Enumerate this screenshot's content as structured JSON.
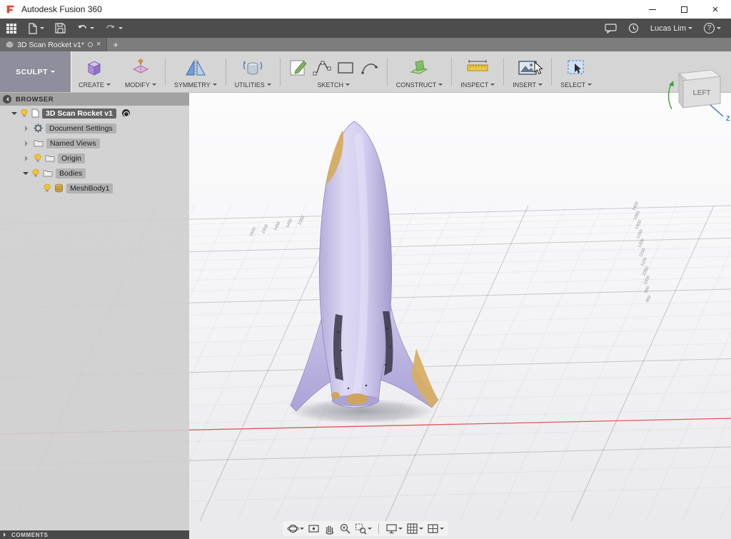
{
  "window": {
    "title": "Autodesk Fusion 360"
  },
  "appbar": {
    "user": "Lucas Lim",
    "help_glyph": "?"
  },
  "tabbar": {
    "active_tab": "3D Scan Rocket v1*",
    "close_glyph": "×",
    "new_tab_glyph": "+"
  },
  "ribbon": {
    "workspace": "SCULPT",
    "groups": [
      {
        "label": "CREATE"
      },
      {
        "label": "MODIFY"
      },
      {
        "label": "SYMMETRY"
      },
      {
        "label": "UTILITIES"
      },
      {
        "label": "SKETCH"
      },
      {
        "label": "CONSTRUCT"
      },
      {
        "label": "INSPECT"
      },
      {
        "label": "INSERT"
      },
      {
        "label": "SELECT"
      }
    ]
  },
  "browser": {
    "header": "BROWSER",
    "items": [
      {
        "label": "3D Scan Rocket v1"
      },
      {
        "label": "Document Settings"
      },
      {
        "label": "Named Views"
      },
      {
        "label": "Origin"
      },
      {
        "label": "Bodies"
      },
      {
        "label": "MeshBody1"
      }
    ]
  },
  "viewcube": {
    "face": "LEFT",
    "z_label": "Z"
  },
  "viewport": {
    "grid_labels_right": [
      "1400",
      "1350",
      "1300",
      "1250",
      "1200",
      "1150",
      "1100",
      "1050",
      "1000",
      "950",
      "900"
    ],
    "grid_labels_top": [
      "1550",
      "1500",
      "1450",
      "1400",
      "1350"
    ]
  },
  "comments_bar": {
    "label": "COMMENTS"
  }
}
